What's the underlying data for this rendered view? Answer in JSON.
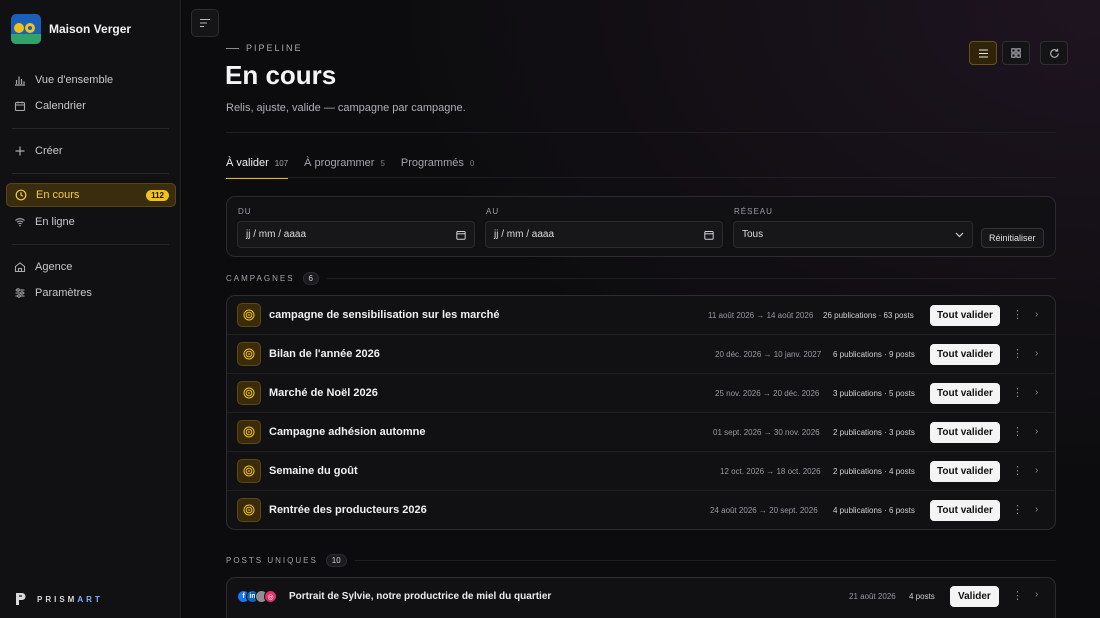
{
  "brand": {
    "name": "Maison Verger"
  },
  "sidebar": {
    "items": [
      {
        "label": "Vue d'ensemble",
        "icon": "bar-chart-icon"
      },
      {
        "label": "Calendrier",
        "icon": "calendar-icon"
      },
      {
        "label": "Créer",
        "icon": "plus-icon"
      },
      {
        "label": "En cours",
        "icon": "clock-icon",
        "badge": "112",
        "active": true
      },
      {
        "label": "En ligne",
        "icon": "wifi-icon"
      },
      {
        "label": "Agence",
        "icon": "building-icon"
      },
      {
        "label": "Paramètres",
        "icon": "sliders-icon"
      }
    ],
    "footer": {
      "logo_text_a": "PRISM",
      "logo_text_b": "ART"
    }
  },
  "header": {
    "eyebrow": "PIPELINE",
    "title": "En cours",
    "subtitle": "Relis, ajuste, valide — campagne par campagne."
  },
  "tabs": [
    {
      "label": "À valider",
      "count": "107",
      "active": true
    },
    {
      "label": "À programmer",
      "count": "5"
    },
    {
      "label": "Programmés",
      "count": "0"
    }
  ],
  "filters": {
    "from_label": "DU",
    "to_label": "AU",
    "network_label": "RÉSEAU",
    "from_placeholder": "jj / mm / aaaa",
    "to_placeholder": "jj / mm / aaaa",
    "network_value": "Tous",
    "reset_label": "Réinitialiser"
  },
  "campaigns_section": {
    "title": "CAMPAGNES",
    "count": "6"
  },
  "campaigns": [
    {
      "name": "campagne de sensibilisation sur les marché",
      "dates": "11 août 2026 → 14 août 2026",
      "stats": "26 publications · 63 posts"
    },
    {
      "name": "Bilan de l'année 2026",
      "dates": "20 déc. 2026 → 10 janv. 2027",
      "stats": "6 publications · 9 posts"
    },
    {
      "name": "Marché de Noël 2026",
      "dates": "25 nov. 2026 → 20 déc. 2026",
      "stats": "3 publications · 5 posts"
    },
    {
      "name": "Campagne adhésion automne",
      "dates": "01 sept. 2026 → 30 nov. 2026",
      "stats": "2 publications · 3 posts"
    },
    {
      "name": "Semaine du goût",
      "dates": "12 oct. 2026 → 18 oct. 2026",
      "stats": "2 publications · 4 posts"
    },
    {
      "name": "Rentrée des producteurs 2026",
      "dates": "24 août 2026 → 20 sept. 2026",
      "stats": "4 publications · 6 posts"
    }
  ],
  "campaign_action_label": "Tout valider",
  "posts_section": {
    "title": "POSTS UNIQUES",
    "count": "10"
  },
  "posts": [
    {
      "title": "Portrait de Sylvie, notre productrice de miel du quartier",
      "date": "21 août 2026",
      "count": "4 posts",
      "action": "Valider"
    }
  ],
  "colors": {
    "accent": "#f1c21b",
    "background": "#0b0b0c"
  }
}
